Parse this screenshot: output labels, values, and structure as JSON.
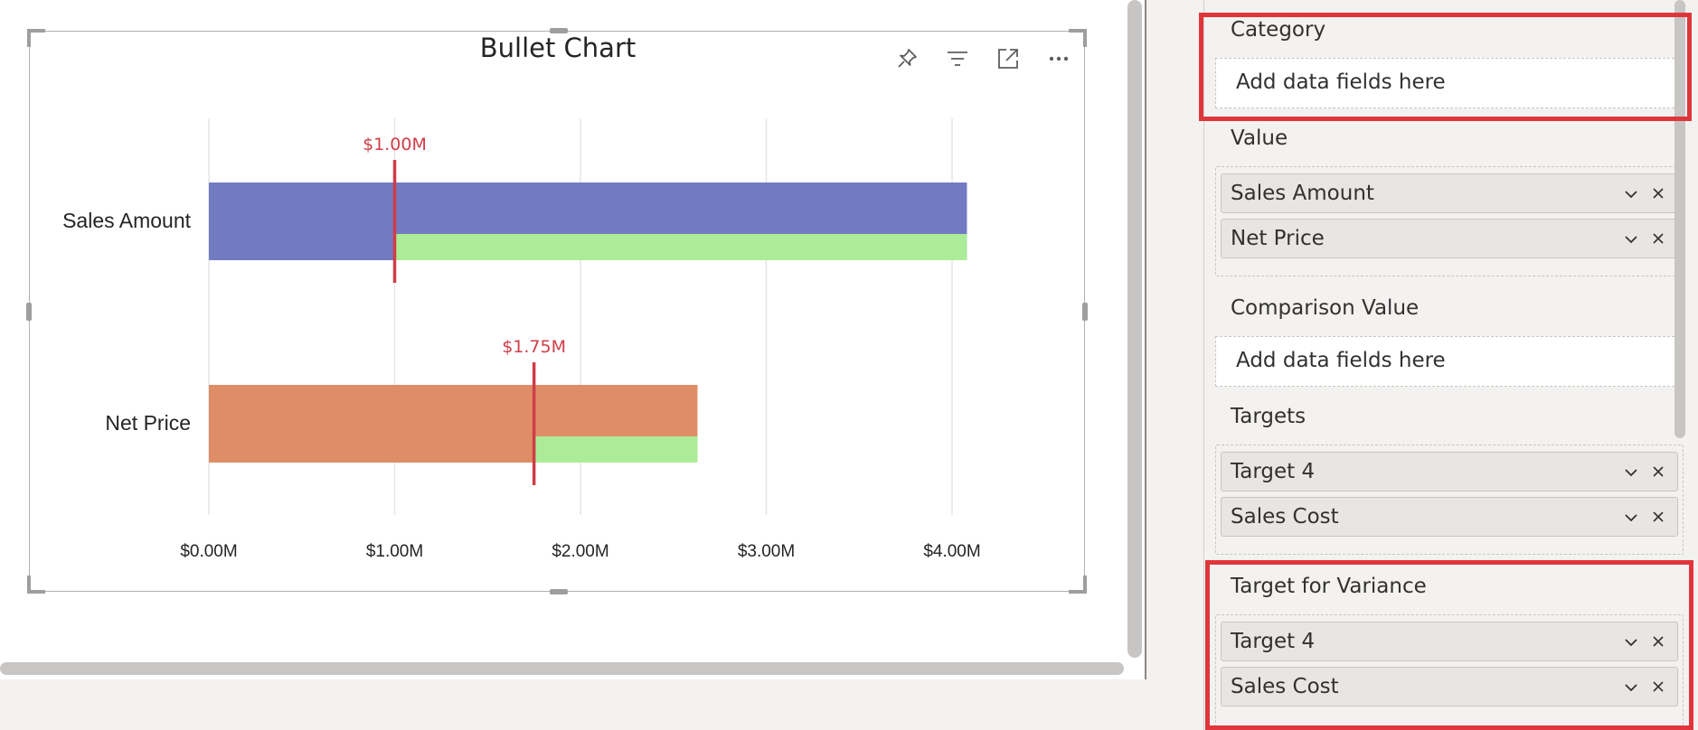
{
  "visual": {
    "title": "Bullet Chart",
    "header_icons": [
      "pin-icon",
      "filter-icon",
      "focus-mode-icon",
      "more-options-icon"
    ]
  },
  "chart_data": {
    "type": "bar",
    "subtype": "bullet",
    "title": "Bullet Chart",
    "categories": [
      "Sales Amount",
      "Net Price"
    ],
    "series": [
      {
        "name": "",
        "values": [
          4.08,
          2.63
        ],
        "colors": [
          "#727bc2",
          "#de8d67"
        ]
      },
      {
        "name": "",
        "values": [
          4.08,
          2.63
        ],
        "color": "#acec98",
        "starts": [
          1.0,
          1.75
        ]
      }
    ],
    "targets": [
      1.0,
      1.75
    ],
    "target_labels": [
      "$1.00M",
      "$1.75M"
    ],
    "target_color": "#cf3d48",
    "xlim": [
      0,
      4.3
    ],
    "x_ticks": [
      0,
      1,
      2,
      3,
      4
    ],
    "x_tick_labels": [
      "$0.00M",
      "$1.00M",
      "$2.00M",
      "$3.00M",
      "$4.00M"
    ],
    "grid": true,
    "xlabel": "",
    "ylabel": ""
  },
  "fields_pane": {
    "sections": [
      {
        "label": "Category",
        "placeholder": "Add data fields here",
        "fields": [],
        "highlighted": true
      },
      {
        "label": "Value",
        "fields": [
          "Sales Amount",
          "Net Price"
        ],
        "highlighted": false
      },
      {
        "label": "Comparison Value",
        "placeholder": "Add data fields here",
        "fields": [],
        "highlighted": false
      },
      {
        "label": "Targets",
        "fields": [
          "Target 4",
          "Sales Cost"
        ],
        "highlighted": false
      },
      {
        "label": "Target for Variance",
        "fields": [
          "Target 4",
          "Sales Cost"
        ],
        "highlighted": true
      }
    ]
  },
  "colors": {
    "highlight": "#e0363b",
    "pane_bg": "#f3f2f1",
    "pill_bg": "#e8e6e4"
  }
}
